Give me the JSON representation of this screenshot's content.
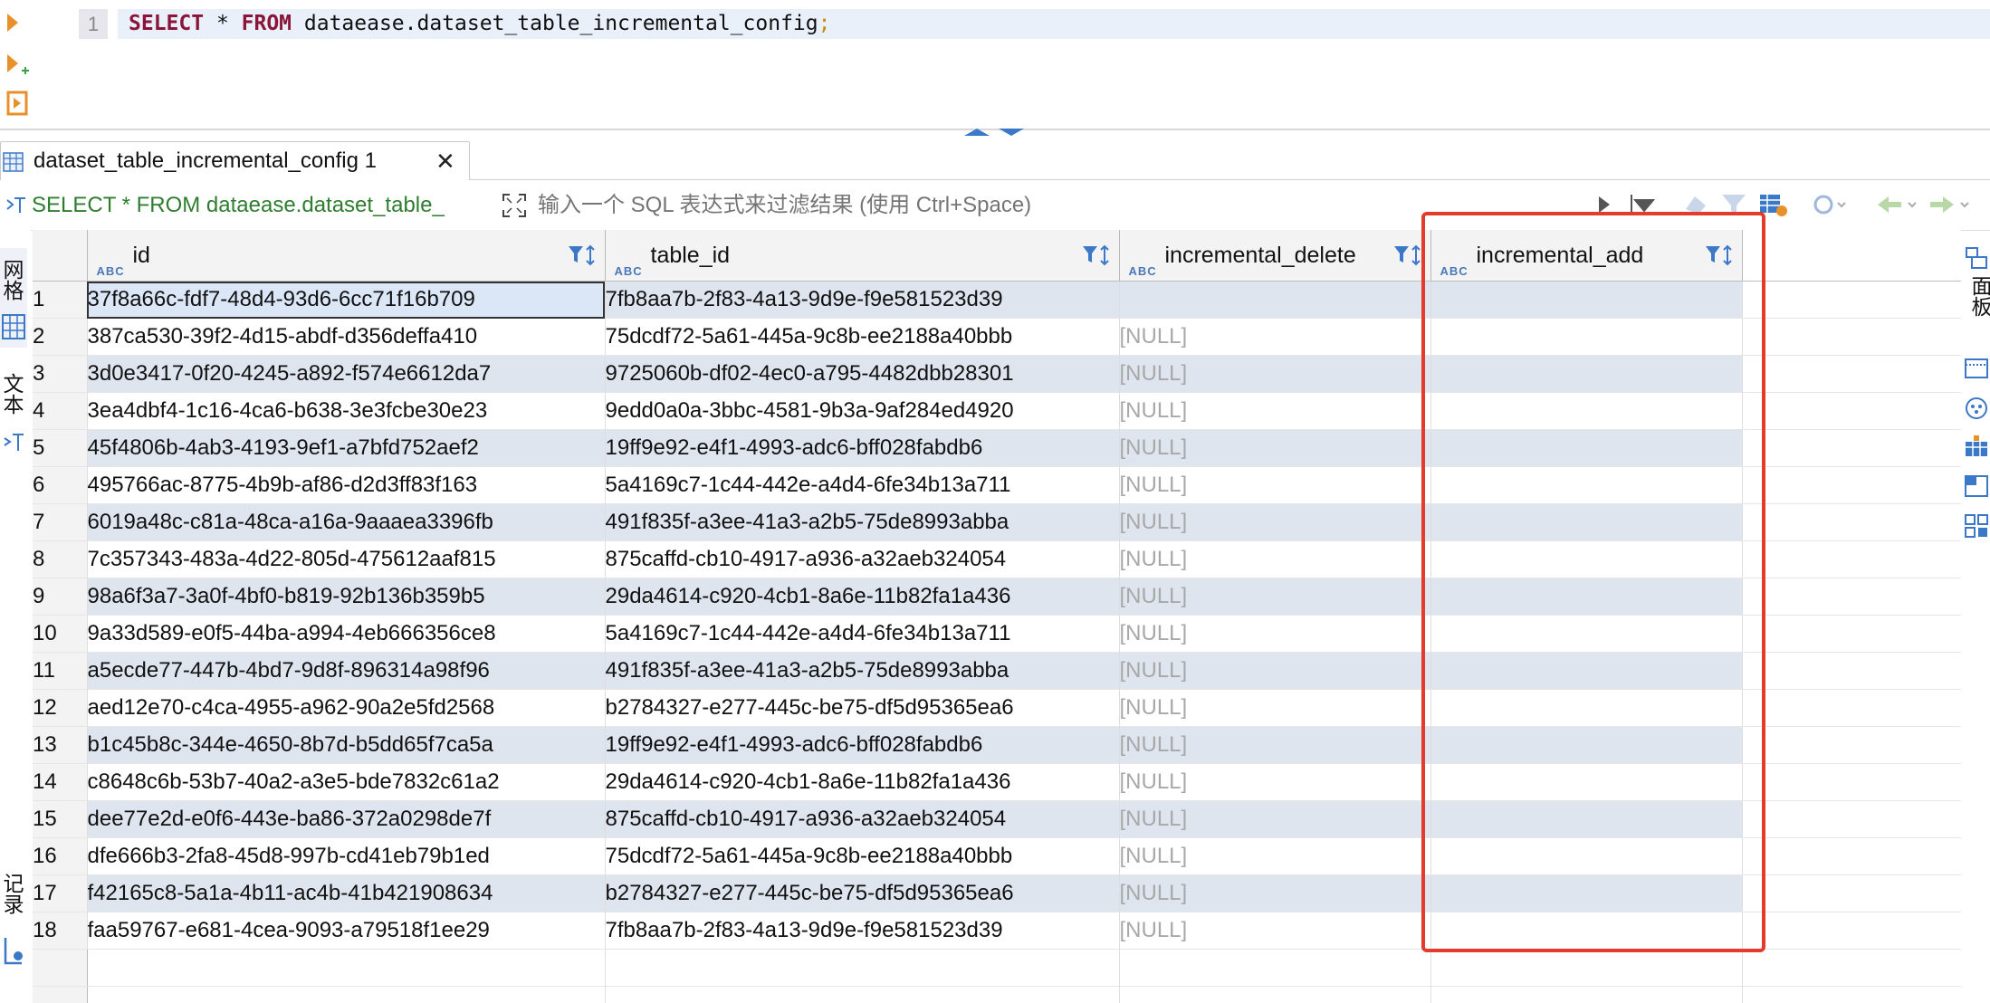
{
  "editor": {
    "line_number": "1",
    "sql_keyword_select": "SELECT",
    "sql_star": " * ",
    "sql_keyword_from": "FROM",
    "sql_table": " dataease.dataset_table_incremental_config",
    "sql_semicolon": ";"
  },
  "results_tab": {
    "label": "dataset_table_incremental_config 1",
    "close_glyph": "✕"
  },
  "filter_bar": {
    "query_preview": "SELECT * FROM dataease.dataset_table_",
    "placeholder": "输入一个 SQL 表达式来过滤结果 (使用 Ctrl+Space)"
  },
  "left_rail": {
    "grid_tab": "网格",
    "text_tab": "文本",
    "record_tab": "记录"
  },
  "right_rail": {
    "panels_tab": "面板"
  },
  "grid": {
    "columns": [
      {
        "name": "id",
        "type": "ABC"
      },
      {
        "name": "table_id",
        "type": "ABC"
      },
      {
        "name": "incremental_delete",
        "type": "ABC"
      },
      {
        "name": "incremental_add",
        "type": "ABC"
      }
    ],
    "rows": [
      {
        "n": "1",
        "id": "37f8a66c-fdf7-48d4-93d6-6cc71f16b709",
        "table_id": "7fb8aa7b-2f83-4a13-9d9e-f9e581523d39",
        "incremental_delete": "",
        "incremental_add": ""
      },
      {
        "n": "2",
        "id": "387ca530-39f2-4d15-abdf-d356deffa410",
        "table_id": "75dcdf72-5a61-445a-9c8b-ee2188a40bbb",
        "incremental_delete": "[NULL]",
        "incremental_add": ""
      },
      {
        "n": "3",
        "id": "3d0e3417-0f20-4245-a892-f574e6612da7",
        "table_id": "9725060b-df02-4ec0-a795-4482dbb28301",
        "incremental_delete": "[NULL]",
        "incremental_add": ""
      },
      {
        "n": "4",
        "id": "3ea4dbf4-1c16-4ca6-b638-3e3fcbe30e23",
        "table_id": "9edd0a0a-3bbc-4581-9b3a-9af284ed4920",
        "incremental_delete": "[NULL]",
        "incremental_add": ""
      },
      {
        "n": "5",
        "id": "45f4806b-4ab3-4193-9ef1-a7bfd752aef2",
        "table_id": "19ff9e92-e4f1-4993-adc6-bff028fabdb6",
        "incremental_delete": "[NULL]",
        "incremental_add": ""
      },
      {
        "n": "6",
        "id": "495766ac-8775-4b9b-af86-d2d3ff83f163",
        "table_id": "5a4169c7-1c44-442e-a4d4-6fe34b13a711",
        "incremental_delete": "[NULL]",
        "incremental_add": ""
      },
      {
        "n": "7",
        "id": "6019a48c-c81a-48ca-a16a-9aaaea3396fb",
        "table_id": "491f835f-a3ee-41a3-a2b5-75de8993abba",
        "incremental_delete": "[NULL]",
        "incremental_add": ""
      },
      {
        "n": "8",
        "id": "7c357343-483a-4d22-805d-475612aaf815",
        "table_id": "875caffd-cb10-4917-a936-a32aeb324054",
        "incremental_delete": "[NULL]",
        "incremental_add": ""
      },
      {
        "n": "9",
        "id": "98a6f3a7-3a0f-4bf0-b819-92b136b359b5",
        "table_id": "29da4614-c920-4cb1-8a6e-11b82fa1a436",
        "incremental_delete": "[NULL]",
        "incremental_add": ""
      },
      {
        "n": "10",
        "id": "9a33d589-e0f5-44ba-a994-4eb666356ce8",
        "table_id": "5a4169c7-1c44-442e-a4d4-6fe34b13a711",
        "incremental_delete": "[NULL]",
        "incremental_add": ""
      },
      {
        "n": "11",
        "id": "a5ecde77-447b-4bd7-9d8f-896314a98f96",
        "table_id": "491f835f-a3ee-41a3-a2b5-75de8993abba",
        "incremental_delete": "[NULL]",
        "incremental_add": ""
      },
      {
        "n": "12",
        "id": "aed12e70-c4ca-4955-a962-90a2e5fd2568",
        "table_id": "b2784327-e277-445c-be75-df5d95365ea6",
        "incremental_delete": "[NULL]",
        "incremental_add": ""
      },
      {
        "n": "13",
        "id": "b1c45b8c-344e-4650-8b7d-b5dd65f7ca5a",
        "table_id": "19ff9e92-e4f1-4993-adc6-bff028fabdb6",
        "incremental_delete": "[NULL]",
        "incremental_add": ""
      },
      {
        "n": "14",
        "id": "c8648c6b-53b7-40a2-a3e5-bde7832c61a2",
        "table_id": "29da4614-c920-4cb1-8a6e-11b82fa1a436",
        "incremental_delete": "[NULL]",
        "incremental_add": ""
      },
      {
        "n": "15",
        "id": "dee77e2d-e0f6-443e-ba86-372a0298de7f",
        "table_id": "875caffd-cb10-4917-a936-a32aeb324054",
        "incremental_delete": "[NULL]",
        "incremental_add": ""
      },
      {
        "n": "16",
        "id": "dfe666b3-2fa8-45d8-997b-cd41eb79b1ed",
        "table_id": "75dcdf72-5a61-445a-9c8b-ee2188a40bbb",
        "incremental_delete": "[NULL]",
        "incremental_add": ""
      },
      {
        "n": "17",
        "id": "f42165c8-5a1a-4b11-ac4b-41b421908634",
        "table_id": "b2784327-e277-445c-be75-df5d95365ea6",
        "incremental_delete": "[NULL]",
        "incremental_add": ""
      },
      {
        "n": "18",
        "id": "faa59767-e681-4cea-9093-a79518f1ee29",
        "table_id": "7fb8aa7b-2f83-4a13-9d9e-f9e581523d39",
        "incremental_delete": "[NULL]",
        "incremental_add": ""
      }
    ]
  },
  "icons": {
    "run": "play-icon",
    "run_new_tab": "play-plus-icon",
    "explain": "explain-plan-icon",
    "table": "table-icon",
    "filter": "filter-icon"
  },
  "colors": {
    "keyword": "#8a1538",
    "filter_query": "#2f7d2f",
    "null_text": "#a8a8a8",
    "alt_row": "#dfe5ef",
    "highlight_box": "#e53b2c"
  }
}
